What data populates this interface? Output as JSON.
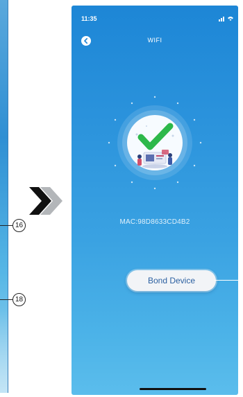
{
  "left_panel": {
    "callouts": [
      "16",
      "18"
    ]
  },
  "status_bar": {
    "time": "11:35",
    "icons": "signal-icon wifi-icon"
  },
  "header": {
    "title": "WIFI",
    "back_icon": "back-chevron-icon"
  },
  "main": {
    "illustration": "success-check-illustration",
    "mac_text": "MAC:98D8633CD4B2",
    "bond_button_label": "Bond Device"
  },
  "colors": {
    "background_top": "#1d86d6",
    "background_bottom": "#5bbdec",
    "check_green": "#2db84a",
    "button_text": "#2b5fa0"
  }
}
